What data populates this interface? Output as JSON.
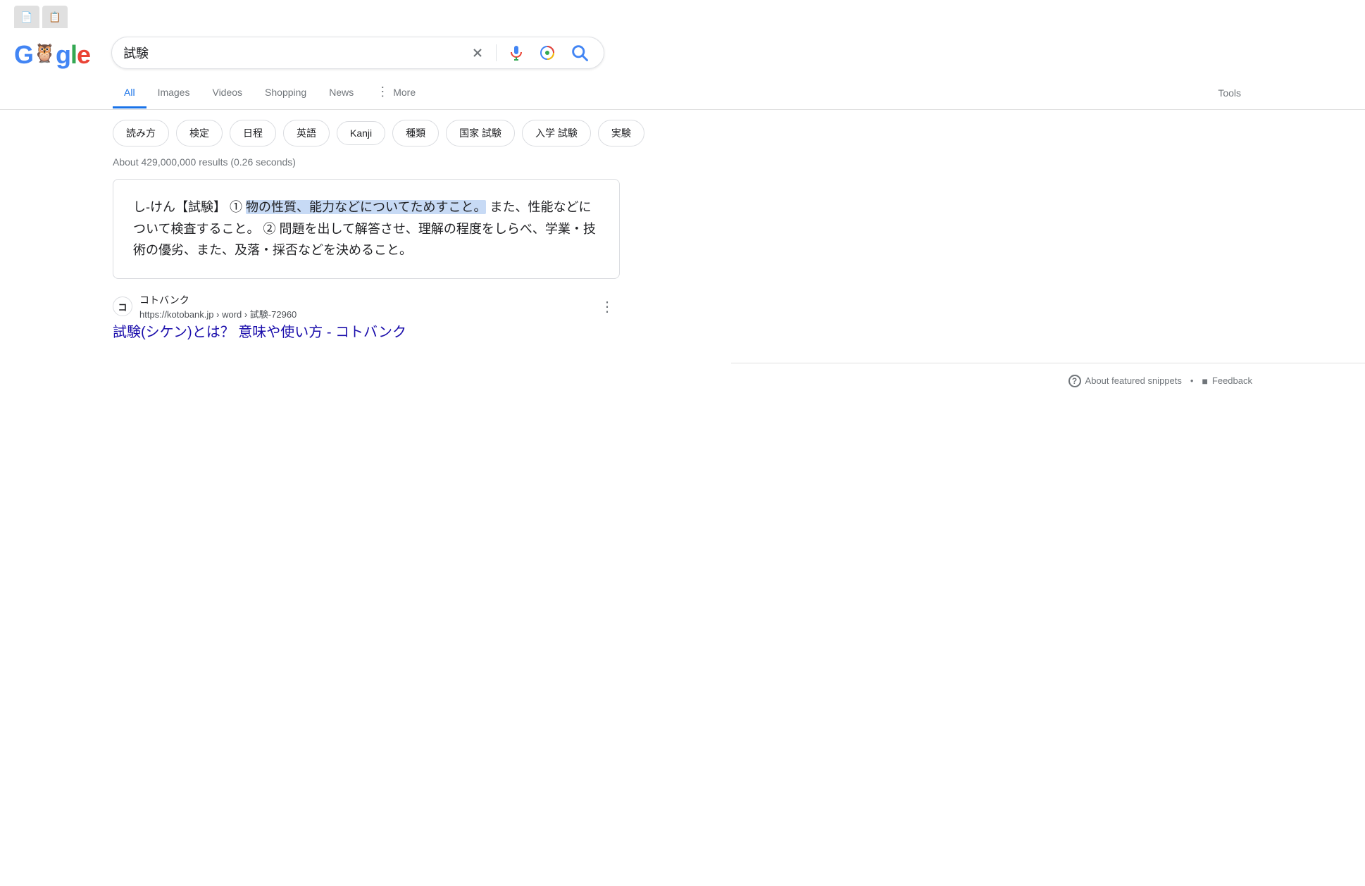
{
  "browser": {
    "tab_icons": [
      "📄",
      "📋"
    ]
  },
  "header": {
    "logo": {
      "letters": [
        "G",
        "o",
        "o",
        "g",
        "l",
        "e"
      ]
    },
    "search_input": {
      "value": "試験",
      "placeholder": ""
    },
    "icons": {
      "clear": "×",
      "mic": "mic",
      "lens": "lens",
      "search": "search"
    }
  },
  "nav": {
    "tabs": [
      {
        "label": "All",
        "active": true
      },
      {
        "label": "Images",
        "active": false
      },
      {
        "label": "Videos",
        "active": false
      },
      {
        "label": "Shopping",
        "active": false
      },
      {
        "label": "News",
        "active": false
      },
      {
        "label": "More",
        "active": false
      }
    ],
    "tools_label": "Tools"
  },
  "suggestions": {
    "pills": [
      {
        "label": "読み方"
      },
      {
        "label": "検定"
      },
      {
        "label": "日程"
      },
      {
        "label": "英語"
      },
      {
        "label": "Kanji"
      },
      {
        "label": "種類"
      },
      {
        "label": "国家 試験"
      },
      {
        "label": "入学 試験"
      },
      {
        "label": "実験"
      }
    ]
  },
  "results": {
    "count_text": "About 429,000,000 results (0.26 seconds)",
    "featured_snippet": {
      "text_before_highlight": "し‐けん【試験】 ① ",
      "highlighted_text": "物の性質、能力などについてためすこと。",
      "text_after_highlight": " また、性能などについて検査すること。 ② 問題を出して解答させ、理解の程度をしらべ、学業・技術の優劣、また、及落・採否などを決めること。"
    },
    "items": [
      {
        "favicon_text": "コ",
        "site_name": "コトバンク",
        "url": "https://kotobank.jp › word › 試験-72960",
        "title": "試験(シケン)とは？ 意味や使い方 - コトバンク"
      }
    ]
  },
  "footer": {
    "about_snippets_text": "About featured snippets",
    "separator": "•",
    "feedback_text": "Feedback",
    "help_icon": "?",
    "feedback_icon": "■"
  }
}
